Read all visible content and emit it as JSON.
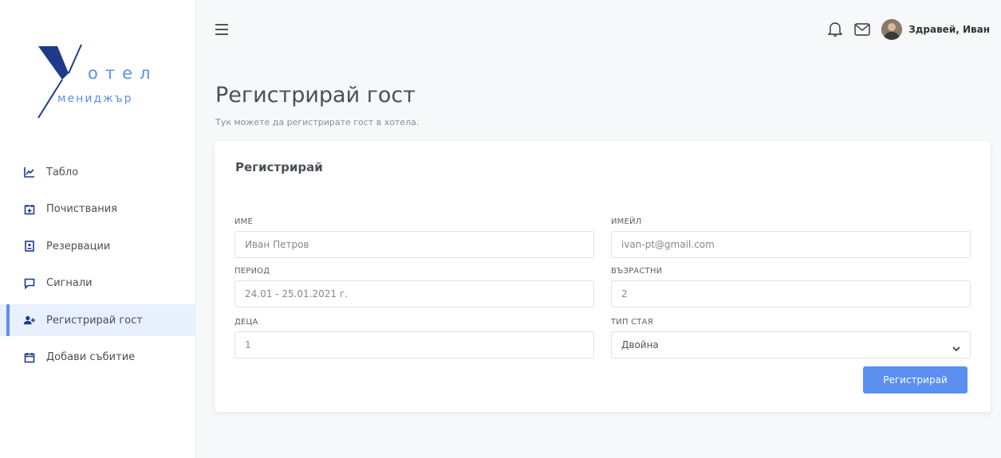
{
  "brand": {
    "line1": "отел",
    "line2": "мениджър",
    "accent": "#5b8ff0"
  },
  "sidebar": {
    "items": [
      {
        "label": "Табло",
        "icon": "chart-line-icon",
        "active": false
      },
      {
        "label": "Почиствания",
        "icon": "calendar-plus-icon",
        "active": false
      },
      {
        "label": "Резервации",
        "icon": "booking-icon",
        "active": false
      },
      {
        "label": "Сигнали",
        "icon": "message-icon",
        "active": false
      },
      {
        "label": "Регистрирай гост",
        "icon": "user-plus-icon",
        "active": true
      },
      {
        "label": "Добави събитие",
        "icon": "calendar-icon",
        "active": false
      }
    ]
  },
  "topbar": {
    "greeting": "Здравей, Иван"
  },
  "page": {
    "title": "Регистрирай гост",
    "subtitle": "Тук можете да регистрирате гост в хотела."
  },
  "form": {
    "title": "Регистрирай",
    "name": {
      "label": "ИМЕ",
      "value": "Иван Петров"
    },
    "email": {
      "label": "ИМЕЙЛ",
      "value": "ivan-pt@gmail.com"
    },
    "period": {
      "label": "ПЕРИОД",
      "value": "24.01 - 25.01.2021 г."
    },
    "adults": {
      "label": "ВЪЗРАСТНИ",
      "value": "2"
    },
    "children": {
      "label": "ДЕЦА",
      "value": "1"
    },
    "room_type": {
      "label": "ТИП СТАЯ",
      "value": "Двойна"
    },
    "submit_label": "Регистрирай"
  }
}
